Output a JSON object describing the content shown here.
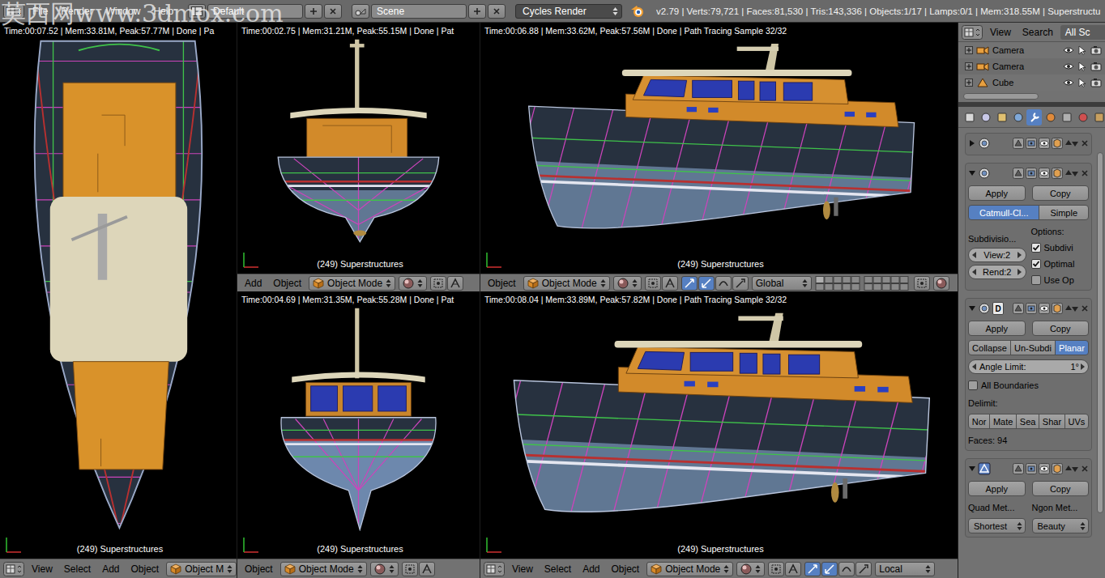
{
  "watermark": "莫西网www.3dmox.com",
  "top_bar": {
    "menus": [
      "File",
      "Render",
      "Window",
      "Help"
    ],
    "layout": "Default",
    "scene": "Scene",
    "engine": "Cycles Render",
    "stats": "v2.79 | Verts:79,721 | Faces:81,530 | Tris:143,336 | Objects:1/17 | Lamps:0/1 | Mem:318.55M | Superstructu"
  },
  "columns": [
    {
      "viewports": [
        {
          "view": "top",
          "info": "Time:00:07.52 | Mem:33.81M, Peak:57.77M | Done | Pa",
          "label": "(249) Superstructures",
          "header": {
            "editor_icon": true,
            "menus": [
              "View",
              "Select",
              "Add",
              "Object"
            ],
            "mode": "Object M",
            "shading": false,
            "manipulators": false,
            "orientation": "",
            "layers": false
          }
        }
      ]
    },
    {
      "viewports": [
        {
          "view": "rear",
          "info": "Time:00:02.75 | Mem:31.21M, Peak:55.15M | Done | Pat",
          "label": "(249) Superstructures",
          "header": {
            "editor_icon": false,
            "menus": [
              "Add",
              "Object"
            ],
            "mode": "Object Mode",
            "shading": true,
            "manipulators": false,
            "orientation": "",
            "layers": false
          }
        },
        {
          "view": "front",
          "info": "Time:00:04.69 | Mem:31.35M, Peak:55.28M | Done | Pat",
          "label": "(249) Superstructures",
          "header": {
            "editor_icon": false,
            "menus": [
              "Object"
            ],
            "mode": "Object Mode",
            "shading": true,
            "manipulators": false,
            "orientation": "",
            "layers": false
          }
        }
      ]
    },
    {
      "viewports": [
        {
          "view": "side",
          "info": "Time:00:06.88 | Mem:33.62M, Peak:57.56M | Done | Path Tracing Sample 32/32",
          "label": "(249) Superstructures",
          "header": {
            "editor_icon": false,
            "menus": [
              "Object"
            ],
            "mode": "Object Mode",
            "shading": true,
            "manipulators": true,
            "orientation": "Global",
            "layers": true
          }
        },
        {
          "view": "side",
          "info": "Time:00:08.04 | Mem:33.89M, Peak:57.82M | Done | Path Tracing Sample 32/32",
          "label": "(249) Superstructures",
          "header": {
            "editor_icon": true,
            "menus": [
              "View",
              "Select",
              "Add",
              "Object"
            ],
            "mode": "Object Mode",
            "shading": true,
            "manipulators": true,
            "orientation": "Local",
            "layers": false
          }
        }
      ]
    }
  ],
  "outliner": {
    "menus": [
      "View",
      "Search"
    ],
    "filter": "All Sc",
    "rows": [
      {
        "name": "Camera",
        "kind": "camera",
        "visible": true,
        "selectable": true,
        "renderable": true
      },
      {
        "name": "Camera",
        "kind": "camera",
        "visible": true,
        "selectable": true,
        "renderable": true
      },
      {
        "name": "Cube",
        "kind": "mesh",
        "visible": true,
        "selectable": true,
        "renderable": true
      }
    ]
  },
  "properties": {
    "tabs": [
      {
        "selected": false
      },
      {
        "selected": false
      },
      {
        "selected": false
      },
      {
        "selected": false
      },
      {
        "selected": true
      },
      {
        "selected": false
      },
      {
        "selected": false
      },
      {
        "selected": false
      },
      {
        "selected": false
      }
    ],
    "modifiers": [
      {
        "kind": "collapsed",
        "expanded": false
      },
      {
        "kind": "subsurf",
        "expanded": true,
        "actions": [
          "Apply",
          "Copy"
        ],
        "types": [
          {
            "label": "Catmull-Cl...",
            "selected": true
          },
          {
            "label": "Simple",
            "selected": false
          }
        ],
        "levels_label": "Subdivisio...",
        "levels": [
          "View:2",
          "Rend:2"
        ],
        "options_label": "Options:",
        "options": [
          {
            "label": "Subdivi",
            "checked": true
          },
          {
            "label": "Optimal",
            "checked": true
          },
          {
            "label": "Use Op",
            "checked": false
          }
        ]
      },
      {
        "kind": "decimate",
        "expanded": true,
        "badge": "D",
        "actions": [
          "Apply",
          "Copy"
        ],
        "types": [
          {
            "label": "Collapse",
            "selected": false
          },
          {
            "label": "Un-Subdi",
            "selected": false
          },
          {
            "label": "Planar",
            "selected": true
          }
        ],
        "angle": {
          "label": "Angle Limit:",
          "value": "1°"
        },
        "all_boundaries": {
          "label": "All Boundaries",
          "checked": false
        },
        "delimit_label": "Delimit:",
        "delimit": [
          {
            "label": "Nor",
            "selected": false
          },
          {
            "label": "Mate",
            "selected": false
          },
          {
            "label": "Sea",
            "selected": false
          },
          {
            "label": "Shar",
            "selected": false
          },
          {
            "label": "UVs",
            "selected": false
          }
        ],
        "faces": "Faces: 94"
      },
      {
        "kind": "triangulate",
        "expanded": true,
        "actions": [
          "Apply",
          "Copy"
        ],
        "labels": [
          "Quad Met...",
          "Ngon Met..."
        ],
        "methods": [
          "Shortest",
          "Beauty"
        ]
      }
    ]
  }
}
